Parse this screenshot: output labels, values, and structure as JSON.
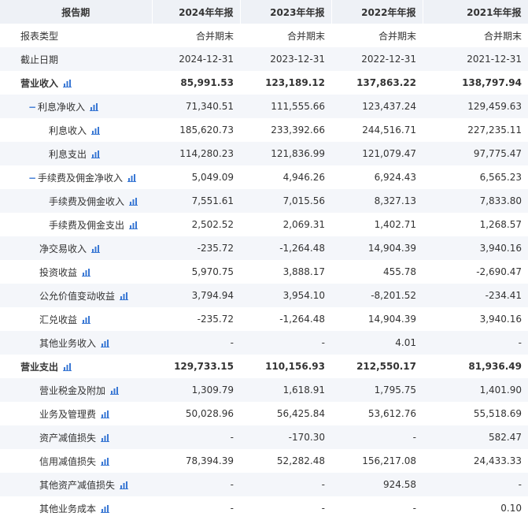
{
  "header": {
    "period_label": "报告期",
    "years": [
      "2024年年报",
      "2023年年报",
      "2022年年报",
      "2021年年报"
    ]
  },
  "rows": [
    {
      "label": "报表类型",
      "values": [
        "合并期末",
        "合并期末",
        "合并期末",
        "合并期末"
      ]
    },
    {
      "label": "截止日期",
      "values": [
        "2024-12-31",
        "2023-12-31",
        "2022-12-31",
        "2021-12-31"
      ]
    },
    {
      "label": "营业收入",
      "values": [
        "85,991.53",
        "123,189.12",
        "137,863.22",
        "138,797.94"
      ]
    },
    {
      "label": "利息净收入",
      "values": [
        "71,340.51",
        "111,555.66",
        "123,437.24",
        "129,459.63"
      ]
    },
    {
      "label": "利息收入",
      "values": [
        "185,620.73",
        "233,392.66",
        "244,516.71",
        "227,235.11"
      ]
    },
    {
      "label": "利息支出",
      "values": [
        "114,280.23",
        "121,836.99",
        "121,079.47",
        "97,775.47"
      ]
    },
    {
      "label": "手续费及佣金净收入",
      "values": [
        "5,049.09",
        "4,946.26",
        "6,924.43",
        "6,565.23"
      ]
    },
    {
      "label": "手续费及佣金收入",
      "values": [
        "7,551.61",
        "7,015.56",
        "8,327.13",
        "7,833.80"
      ]
    },
    {
      "label": "手续费及佣金支出",
      "values": [
        "2,502.52",
        "2,069.31",
        "1,402.71",
        "1,268.57"
      ]
    },
    {
      "label": "净交易收入",
      "values": [
        "-235.72",
        "-1,264.48",
        "14,904.39",
        "3,940.16"
      ]
    },
    {
      "label": "投资收益",
      "values": [
        "5,970.75",
        "3,888.17",
        "455.78",
        "-2,690.47"
      ]
    },
    {
      "label": "公允价值变动收益",
      "values": [
        "3,794.94",
        "3,954.10",
        "-8,201.52",
        "-234.41"
      ]
    },
    {
      "label": "汇兑收益",
      "values": [
        "-235.72",
        "-1,264.48",
        "14,904.39",
        "3,940.16"
      ]
    },
    {
      "label": "其他业务收入",
      "values": [
        "-",
        "-",
        "4.01",
        "-"
      ]
    },
    {
      "label": "营业支出",
      "values": [
        "129,733.15",
        "110,156.93",
        "212,550.17",
        "81,936.49"
      ]
    },
    {
      "label": "营业税金及附加",
      "values": [
        "1,309.79",
        "1,618.91",
        "1,795.75",
        "1,401.90"
      ]
    },
    {
      "label": "业务及管理费",
      "values": [
        "50,028.96",
        "56,425.84",
        "53,612.76",
        "55,518.69"
      ]
    },
    {
      "label": "资产减值损失",
      "values": [
        "-",
        "-170.30",
        "-",
        "582.47"
      ]
    },
    {
      "label": "信用减值损失",
      "values": [
        "78,394.39",
        "52,282.48",
        "156,217.08",
        "24,433.33"
      ]
    },
    {
      "label": "其他资产减值损失",
      "values": [
        "-",
        "-",
        "924.58",
        "-"
      ]
    },
    {
      "label": "其他业务成本",
      "values": [
        "-",
        "-",
        "-",
        "0.10"
      ]
    }
  ],
  "symbols": {
    "collapse": "−"
  },
  "icons": {
    "chart": "bar-chart-icon"
  },
  "colors": {
    "header_bg": "#eef1f6",
    "stripe_bg": "#f4f6fa",
    "icon": "#3a78d4"
  }
}
